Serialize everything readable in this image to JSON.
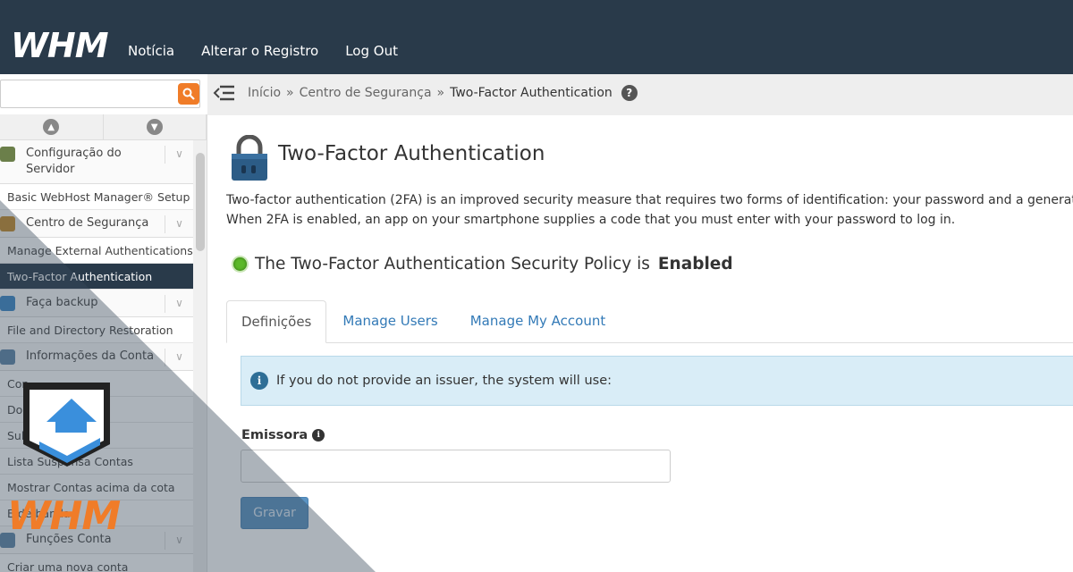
{
  "topbar": {
    "logo_text": "WHM",
    "nav": [
      "Notícia",
      "Alterar o Registro",
      "Log Out"
    ]
  },
  "search": {
    "placeholder": "",
    "value": ""
  },
  "breadcrumb": {
    "items": [
      "Início",
      "Centro de Segurança",
      "Two-Factor Authentication"
    ],
    "separator": "»"
  },
  "sidebar": {
    "blocks": [
      {
        "type": "cat",
        "label": "Configuração do Servidor",
        "icon": "server-icon",
        "color": "#6b7f4a"
      },
      {
        "type": "item",
        "label": "Basic WebHost Manager® Setup"
      },
      {
        "type": "cat",
        "label": "Centro de Segurança",
        "icon": "padlock-icon",
        "color": "#c58a2a"
      },
      {
        "type": "item",
        "label": "Manage External Authentications"
      },
      {
        "type": "item",
        "label": "Two-Factor Authentication",
        "active": true
      },
      {
        "type": "cat",
        "label": "Faça backup",
        "icon": "backup-icon",
        "color": "#3b87c6"
      },
      {
        "type": "item",
        "label": "File and Directory Restoration"
      },
      {
        "type": "cat",
        "label": "Informações da Conta",
        "icon": "account-info-icon",
        "color": "#5d86a8"
      },
      {
        "type": "item",
        "label": "Con"
      },
      {
        "type": "item",
        "label": "Do                dos lista"
      },
      {
        "type": "item",
        "label": "Sub"
      },
      {
        "type": "item",
        "label": "Lista Suspensa Contas"
      },
      {
        "type": "item",
        "label": "Mostrar Contas acima da cota"
      },
      {
        "type": "item",
        "label": "E                      de banda"
      },
      {
        "type": "cat",
        "label": "Funções Conta",
        "icon": "user-functions-icon",
        "color": "#5d86a8"
      },
      {
        "type": "item",
        "label": "Criar uma nova conta"
      }
    ]
  },
  "main": {
    "title": "Two-Factor Authentication",
    "description": [
      "Two-factor authentication (2FA) is an improved security measure that requires two forms of identification: your password and a generat",
      "When 2FA is enabled, an app on your smartphone supplies a code that you must enter with your password to log in."
    ],
    "policy_text": "The Two-Factor Authentication Security Policy is",
    "policy_state": "Enabled",
    "tabs": [
      {
        "label": "Definições",
        "active": true
      },
      {
        "label": "Manage Users"
      },
      {
        "label": "Manage My Account"
      }
    ],
    "alert": "If you do not provide an issuer, the system will use:",
    "issuer_label": "Emissora",
    "issuer_value": "",
    "save_label": "Gravar"
  },
  "colors": {
    "topbar": "#293a4a",
    "accent": "#f07c28",
    "link": "#337ab7",
    "alert_bg": "#d9edf7",
    "button": "#5b93c2",
    "status_enabled": "#5cb82a"
  },
  "watermark": {
    "logo_text": "WHM"
  }
}
